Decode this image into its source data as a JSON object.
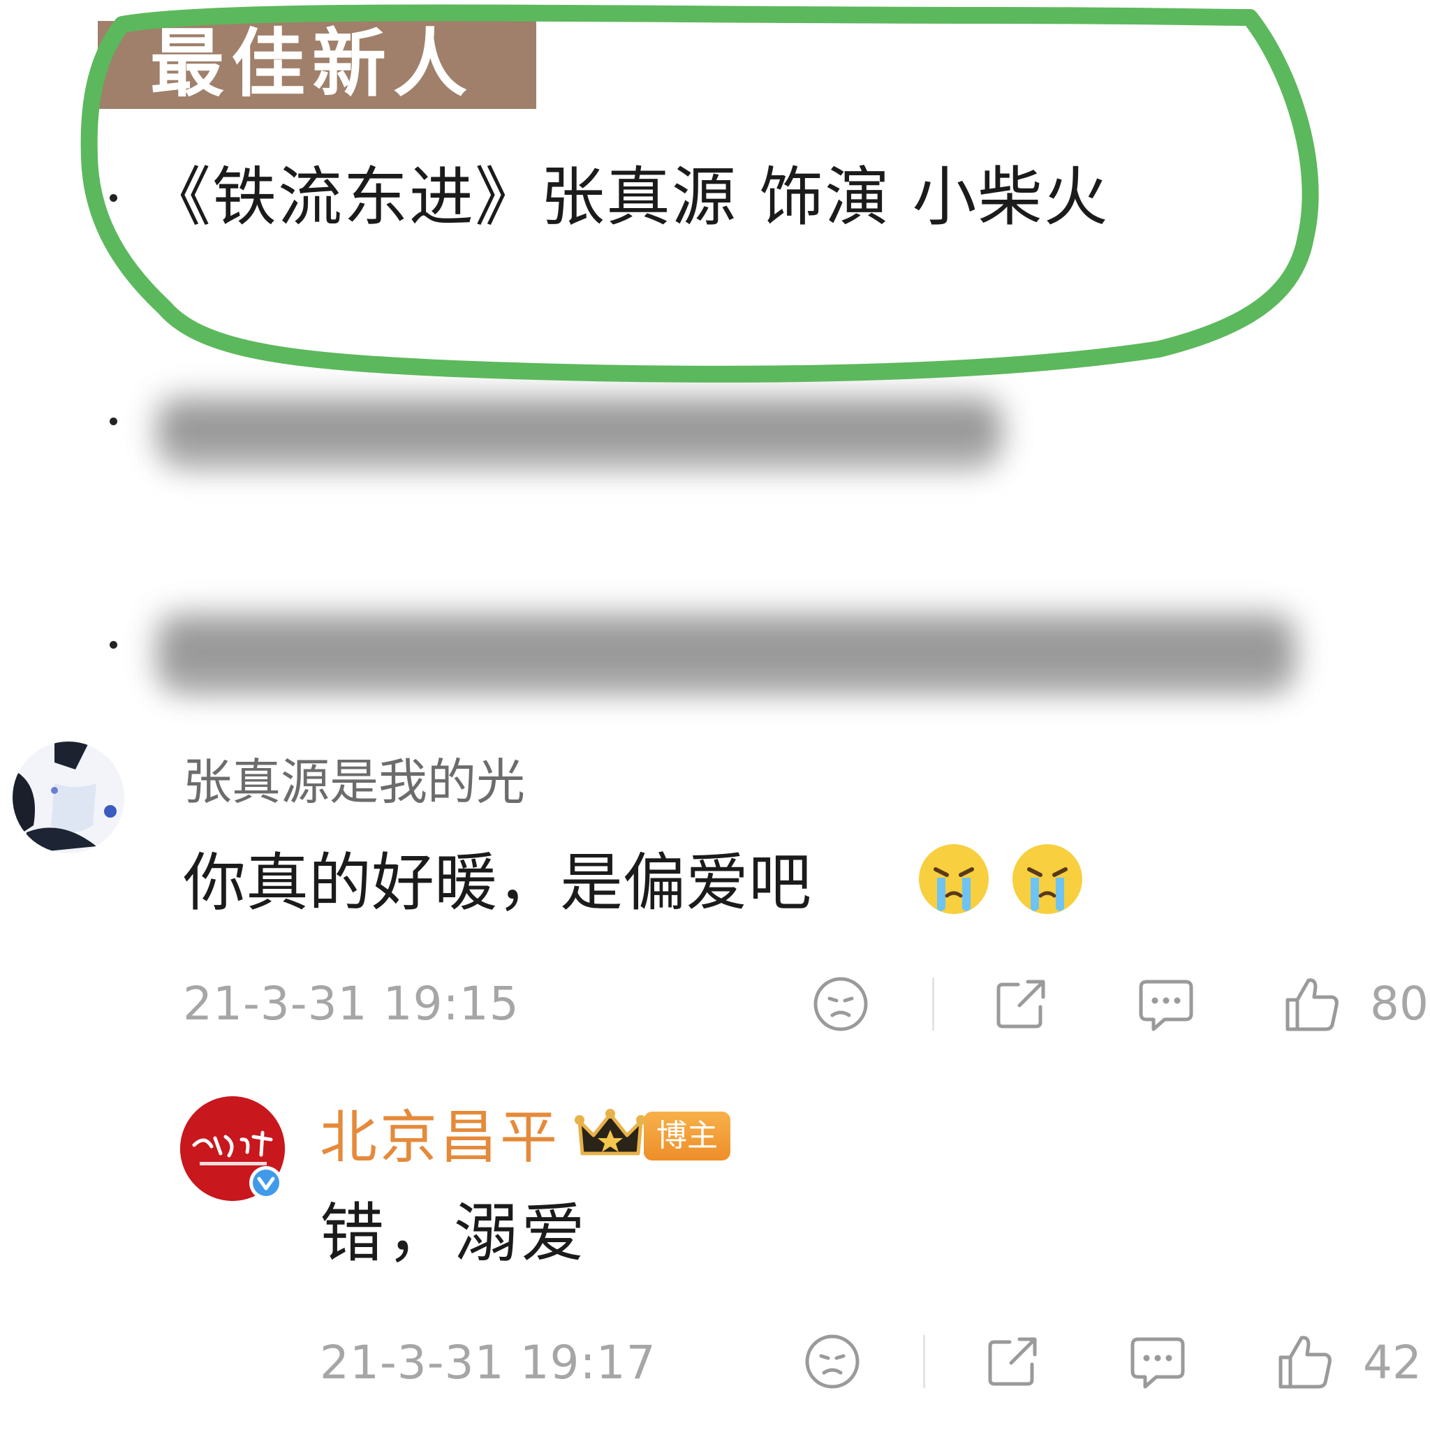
{
  "award": {
    "title": "最佳新人",
    "entry": "《铁流东进》张真源 饰演 小柴火"
  },
  "comments": [
    {
      "username": "张真源是我的光",
      "text": "你真的好暖，是偏爱吧",
      "emojis": [
        "crying-emoji",
        "crying-emoji"
      ],
      "timestamp": "21-3-31 19:15",
      "like_count": "80"
    },
    {
      "username": "北京昌平",
      "badge": "博主",
      "avatar_logo": "北京昌平",
      "text": "错，溺爱",
      "timestamp": "21-3-31 19:17",
      "like_count": "42"
    }
  ],
  "colors": {
    "banner": "#a0806a",
    "highlight_circle": "#5cb85c",
    "username_vip": "#e58a3a",
    "meta_gray": "#a6a6a6"
  }
}
